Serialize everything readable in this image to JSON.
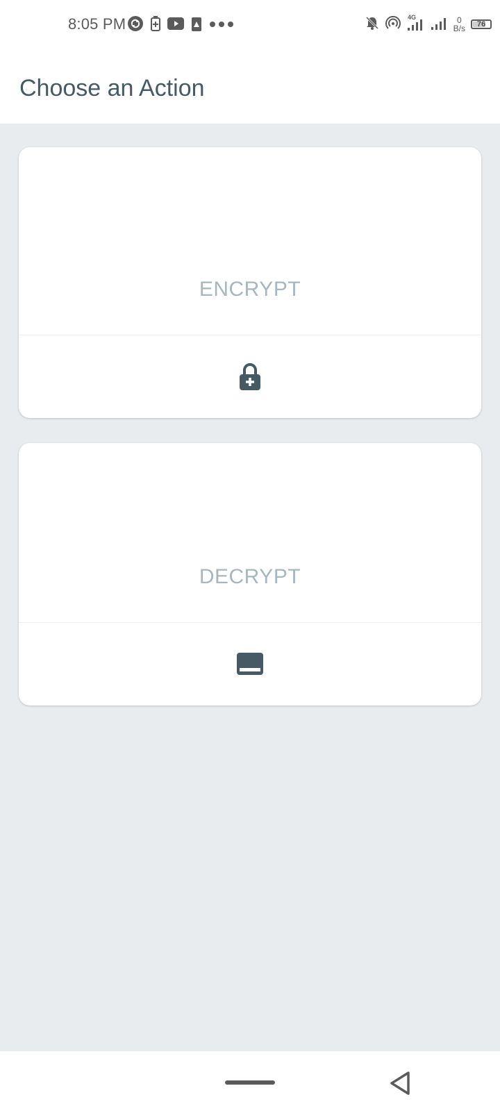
{
  "status_bar": {
    "time": "8:05 PM",
    "network_type": "4G",
    "net_speed_value": "0",
    "net_speed_unit": "B/s",
    "battery_level": "76",
    "battery_fraction": 0.76,
    "icons_left": [
      "sync-icon",
      "battery-saver-icon",
      "youtube-icon",
      "alert-icon",
      "more-dots-icon"
    ],
    "icons_right": [
      "bell-off-icon",
      "hotspot-icon",
      "signal-4g-icon",
      "signal-icon",
      "battery-icon"
    ]
  },
  "app_bar": {
    "title": "Choose an Action"
  },
  "cards": [
    {
      "label": "ENCRYPT",
      "icon": "lock-plus-icon"
    },
    {
      "label": "DECRYPT",
      "icon": "tray-icon"
    }
  ],
  "colors": {
    "title": "#455a64",
    "card_label": "#a7b6bf",
    "icon": "#455a64",
    "background": "#e9ecef",
    "card": "#ffffff"
  },
  "nav_bar": {
    "icons": [
      "home-handle",
      "back-triangle-icon"
    ]
  }
}
